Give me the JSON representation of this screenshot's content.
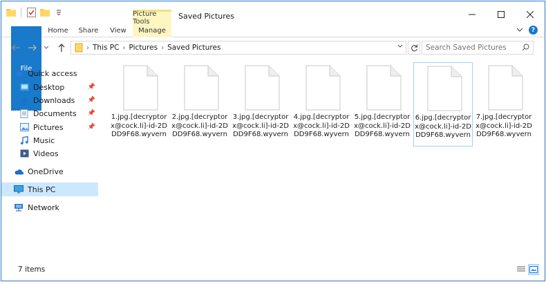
{
  "window": {
    "title": "Saved Pictures",
    "context_tab_header": "Picture Tools",
    "controls": [
      "minimize",
      "maximize",
      "close"
    ]
  },
  "ribbon": {
    "tabs": [
      "File",
      "Home",
      "Share",
      "View",
      "Manage"
    ]
  },
  "address": {
    "crumbs": [
      "This PC",
      "Pictures",
      "Saved Pictures"
    ]
  },
  "search": {
    "placeholder": "Search Saved Pictures"
  },
  "navpane": {
    "items": [
      {
        "label": "Quick access",
        "icon": "star-icon"
      },
      {
        "label": "Desktop",
        "icon": "desktop-folder-icon",
        "pinned": true
      },
      {
        "label": "Downloads",
        "icon": "downloads-folder-icon",
        "pinned": true
      },
      {
        "label": "Documents",
        "icon": "documents-folder-icon",
        "pinned": true
      },
      {
        "label": "Pictures",
        "icon": "pictures-folder-icon",
        "pinned": true
      },
      {
        "label": "Music",
        "icon": "music-folder-icon"
      },
      {
        "label": "Videos",
        "icon": "videos-folder-icon"
      },
      {
        "label": "OneDrive",
        "icon": "onedrive-cloud-icon"
      },
      {
        "label": "This PC",
        "icon": "computer-icon",
        "selected": true
      },
      {
        "label": "Network",
        "icon": "network-icon"
      }
    ]
  },
  "files": [
    {
      "name": "1.jpg.[decryptorx@cock.li]-id-2DDD9F68.wyvern"
    },
    {
      "name": "2.jpg.[decryptorx@cock.li]-id-2DDD9F68.wyvern"
    },
    {
      "name": "3.jpg.[decryptorx@cock.li]-id-2DDD9F68.wyvern"
    },
    {
      "name": "4.jpg.[decryptorx@cock.li]-id-2DDD9F68.wyvern"
    },
    {
      "name": "5.jpg.[decryptorx@cock.li]-id-2DDD9F68.wyvern"
    },
    {
      "name": "6.jpg.[decryptorx@cock.li]-id-2DDD9F68.wyvern",
      "selected": true
    },
    {
      "name": "7.jpg.[decryptorx@cock.li]-id-2DDD9F68.wyvern"
    }
  ],
  "status": {
    "item_count": "7 items"
  },
  "colors": {
    "accent": "#1979ca",
    "selection": "#cce8ff",
    "selection_border": "#99d1ff",
    "context_tab": "#fdf6c2"
  }
}
